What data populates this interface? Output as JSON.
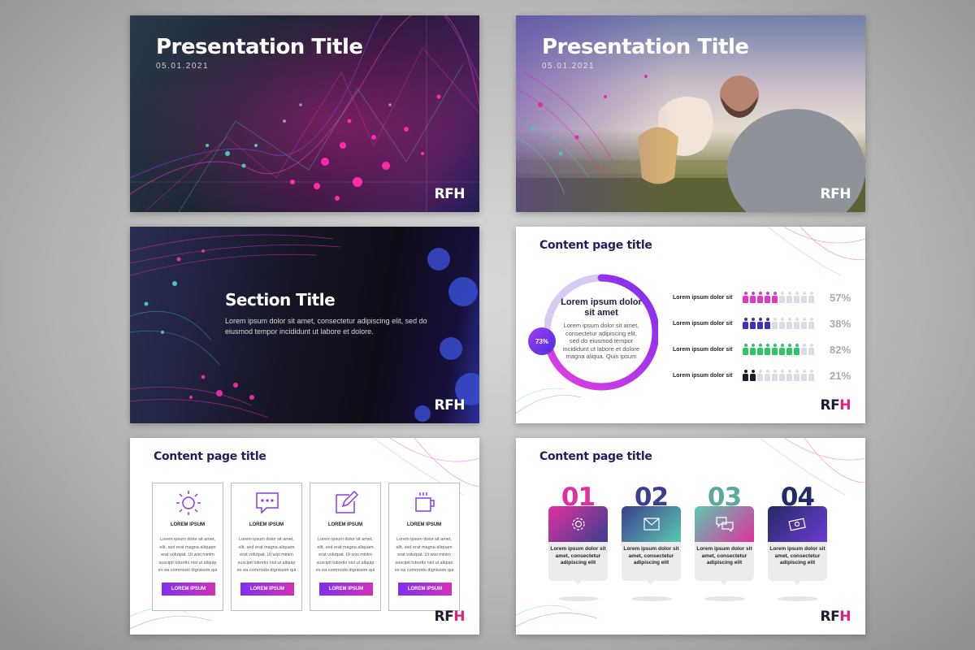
{
  "logo_text": "RFH",
  "slides": {
    "title1": {
      "title": "Presentation Title",
      "date": "05.01.2021"
    },
    "title2": {
      "title": "Presentation Title",
      "date": "05.01.2021"
    },
    "section": {
      "title": "Section Title",
      "body": "Lorem ipsum dolor sit amet, consectetur adipiscing elit, sed do eiusmod tempor incididunt ut labore et dolore."
    },
    "stats": {
      "title": "Content page title",
      "donut_heading": "Lorem ipsum dolor sit amet",
      "donut_body": "Lorem ipsum dolor sit amet, consectetur adipiscing elit, sed do eiusmod tempor incididunt ut labore et dolore magna aliqua. Quis ipsum",
      "donut_percent_label": "73%",
      "donut_fraction": 0.73,
      "rows": [
        {
          "label": "Lorem ipsum dolor sit",
          "value": "57%",
          "filled": 5,
          "color": "#e236c8"
        },
        {
          "label": "Lorem ipsum dolor sit",
          "value": "38%",
          "filled": 4,
          "color": "#3a34b8"
        },
        {
          "label": "Lorem ipsum dolor sit",
          "value": "82%",
          "filled": 8,
          "color": "#2ec46a"
        },
        {
          "label": "Lorem ipsum dolor sit",
          "value": "21%",
          "filled": 2,
          "color": "#1d1d2a"
        }
      ],
      "people_total": 10,
      "empty_color": "#d8dce4"
    },
    "cards": {
      "title": "Content page title",
      "items": [
        {
          "icon": "sun-icon",
          "heading": "LOREM IPSUM",
          "body": "Lorem ipsum dolor sit amet, elit, sed erat magna aliquam erat volutpat. Ut wisi minim suscipit lobortis nisl ut aliquip ex ea commodo dignissim qui",
          "button": "LOREM IPSUM"
        },
        {
          "icon": "chat-bubble-icon",
          "heading": "LOREM IPSUM",
          "body": "Lorem ipsum dolor sit amet, elit, sed erat magna aliquam erat volutpat. Ut wisi minim suscipit lobortis nisl ut aliquip ex ea commodo dignissim qui",
          "button": "LOREM IPSUM"
        },
        {
          "icon": "edit-icon",
          "heading": "LOREM IPSUM",
          "body": "Lorem ipsum dolor sit amet, elit, sed erat magna aliquam erat volutpat. Ut wisi minim suscipit lobortis nisl ut aliquip ex ea commodo dignissim qui",
          "button": "LOREM IPSUM"
        },
        {
          "icon": "coffee-cup-icon",
          "heading": "LOREM IPSUM",
          "body": "Lorem ipsum dolor sit amet, elit, sed erat magna aliquam erat volutpat. Ut wisi minim suscipit lobortis nisl ut aliquip ex ea commodo dignissim qui",
          "button": "LOREM IPSUM"
        }
      ]
    },
    "steps": {
      "title": "Content page title",
      "items": [
        {
          "number": "01",
          "icon": "gear-icon",
          "text": "Lorem ipsum dolor sit amet, consectetur adipiscing elit",
          "num_color": "#e0309e"
        },
        {
          "number": "02",
          "icon": "envelope-icon",
          "text": "Lorem ipsum dolor sit amet, consectetur adipiscing elit",
          "num_color": "#3a3f8e"
        },
        {
          "number": "03",
          "icon": "chat-bubbles-icon",
          "text": "Lorem ipsum dolor sit amet, consectetur adipiscing elit",
          "num_color": "#5aa8a0"
        },
        {
          "number": "04",
          "icon": "money-icon",
          "text": "Lorem ipsum dolor sit amet, consectetur adipiscing elit",
          "num_color": "#232a66"
        }
      ]
    }
  }
}
